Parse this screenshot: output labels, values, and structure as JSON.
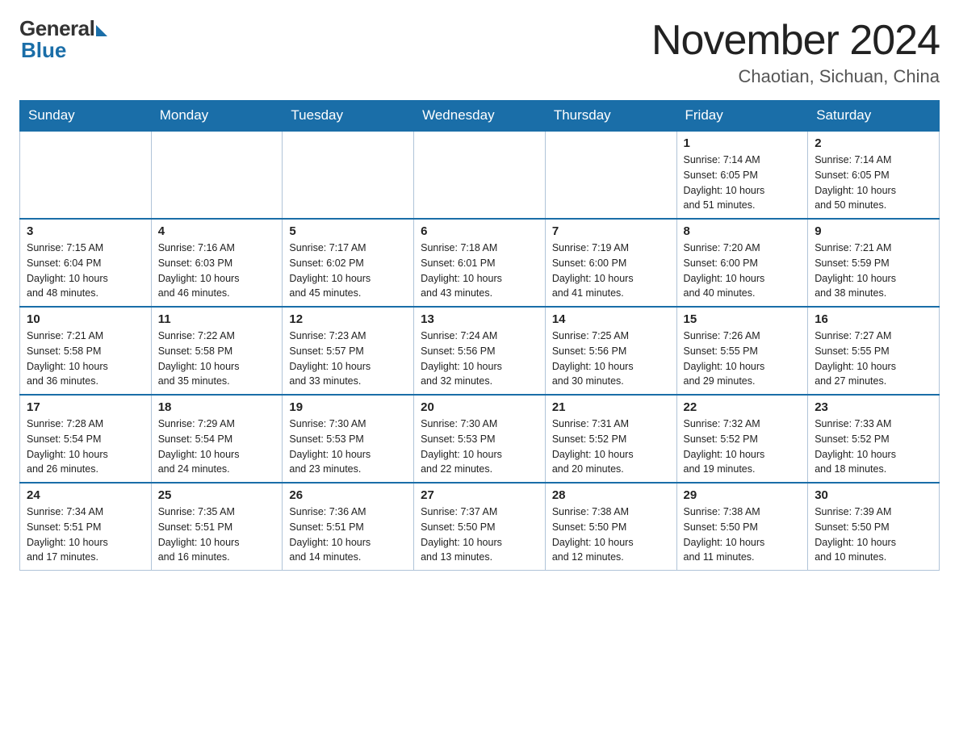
{
  "logo": {
    "general": "General",
    "blue": "Blue"
  },
  "header": {
    "title": "November 2024",
    "location": "Chaotian, Sichuan, China"
  },
  "days_of_week": [
    "Sunday",
    "Monday",
    "Tuesday",
    "Wednesday",
    "Thursday",
    "Friday",
    "Saturday"
  ],
  "weeks": [
    [
      {
        "day": "",
        "info": ""
      },
      {
        "day": "",
        "info": ""
      },
      {
        "day": "",
        "info": ""
      },
      {
        "day": "",
        "info": ""
      },
      {
        "day": "",
        "info": ""
      },
      {
        "day": "1",
        "info": "Sunrise: 7:14 AM\nSunset: 6:05 PM\nDaylight: 10 hours\nand 51 minutes."
      },
      {
        "day": "2",
        "info": "Sunrise: 7:14 AM\nSunset: 6:05 PM\nDaylight: 10 hours\nand 50 minutes."
      }
    ],
    [
      {
        "day": "3",
        "info": "Sunrise: 7:15 AM\nSunset: 6:04 PM\nDaylight: 10 hours\nand 48 minutes."
      },
      {
        "day": "4",
        "info": "Sunrise: 7:16 AM\nSunset: 6:03 PM\nDaylight: 10 hours\nand 46 minutes."
      },
      {
        "day": "5",
        "info": "Sunrise: 7:17 AM\nSunset: 6:02 PM\nDaylight: 10 hours\nand 45 minutes."
      },
      {
        "day": "6",
        "info": "Sunrise: 7:18 AM\nSunset: 6:01 PM\nDaylight: 10 hours\nand 43 minutes."
      },
      {
        "day": "7",
        "info": "Sunrise: 7:19 AM\nSunset: 6:00 PM\nDaylight: 10 hours\nand 41 minutes."
      },
      {
        "day": "8",
        "info": "Sunrise: 7:20 AM\nSunset: 6:00 PM\nDaylight: 10 hours\nand 40 minutes."
      },
      {
        "day": "9",
        "info": "Sunrise: 7:21 AM\nSunset: 5:59 PM\nDaylight: 10 hours\nand 38 minutes."
      }
    ],
    [
      {
        "day": "10",
        "info": "Sunrise: 7:21 AM\nSunset: 5:58 PM\nDaylight: 10 hours\nand 36 minutes."
      },
      {
        "day": "11",
        "info": "Sunrise: 7:22 AM\nSunset: 5:58 PM\nDaylight: 10 hours\nand 35 minutes."
      },
      {
        "day": "12",
        "info": "Sunrise: 7:23 AM\nSunset: 5:57 PM\nDaylight: 10 hours\nand 33 minutes."
      },
      {
        "day": "13",
        "info": "Sunrise: 7:24 AM\nSunset: 5:56 PM\nDaylight: 10 hours\nand 32 minutes."
      },
      {
        "day": "14",
        "info": "Sunrise: 7:25 AM\nSunset: 5:56 PM\nDaylight: 10 hours\nand 30 minutes."
      },
      {
        "day": "15",
        "info": "Sunrise: 7:26 AM\nSunset: 5:55 PM\nDaylight: 10 hours\nand 29 minutes."
      },
      {
        "day": "16",
        "info": "Sunrise: 7:27 AM\nSunset: 5:55 PM\nDaylight: 10 hours\nand 27 minutes."
      }
    ],
    [
      {
        "day": "17",
        "info": "Sunrise: 7:28 AM\nSunset: 5:54 PM\nDaylight: 10 hours\nand 26 minutes."
      },
      {
        "day": "18",
        "info": "Sunrise: 7:29 AM\nSunset: 5:54 PM\nDaylight: 10 hours\nand 24 minutes."
      },
      {
        "day": "19",
        "info": "Sunrise: 7:30 AM\nSunset: 5:53 PM\nDaylight: 10 hours\nand 23 minutes."
      },
      {
        "day": "20",
        "info": "Sunrise: 7:30 AM\nSunset: 5:53 PM\nDaylight: 10 hours\nand 22 minutes."
      },
      {
        "day": "21",
        "info": "Sunrise: 7:31 AM\nSunset: 5:52 PM\nDaylight: 10 hours\nand 20 minutes."
      },
      {
        "day": "22",
        "info": "Sunrise: 7:32 AM\nSunset: 5:52 PM\nDaylight: 10 hours\nand 19 minutes."
      },
      {
        "day": "23",
        "info": "Sunrise: 7:33 AM\nSunset: 5:52 PM\nDaylight: 10 hours\nand 18 minutes."
      }
    ],
    [
      {
        "day": "24",
        "info": "Sunrise: 7:34 AM\nSunset: 5:51 PM\nDaylight: 10 hours\nand 17 minutes."
      },
      {
        "day": "25",
        "info": "Sunrise: 7:35 AM\nSunset: 5:51 PM\nDaylight: 10 hours\nand 16 minutes."
      },
      {
        "day": "26",
        "info": "Sunrise: 7:36 AM\nSunset: 5:51 PM\nDaylight: 10 hours\nand 14 minutes."
      },
      {
        "day": "27",
        "info": "Sunrise: 7:37 AM\nSunset: 5:50 PM\nDaylight: 10 hours\nand 13 minutes."
      },
      {
        "day": "28",
        "info": "Sunrise: 7:38 AM\nSunset: 5:50 PM\nDaylight: 10 hours\nand 12 minutes."
      },
      {
        "day": "29",
        "info": "Sunrise: 7:38 AM\nSunset: 5:50 PM\nDaylight: 10 hours\nand 11 minutes."
      },
      {
        "day": "30",
        "info": "Sunrise: 7:39 AM\nSunset: 5:50 PM\nDaylight: 10 hours\nand 10 minutes."
      }
    ]
  ]
}
